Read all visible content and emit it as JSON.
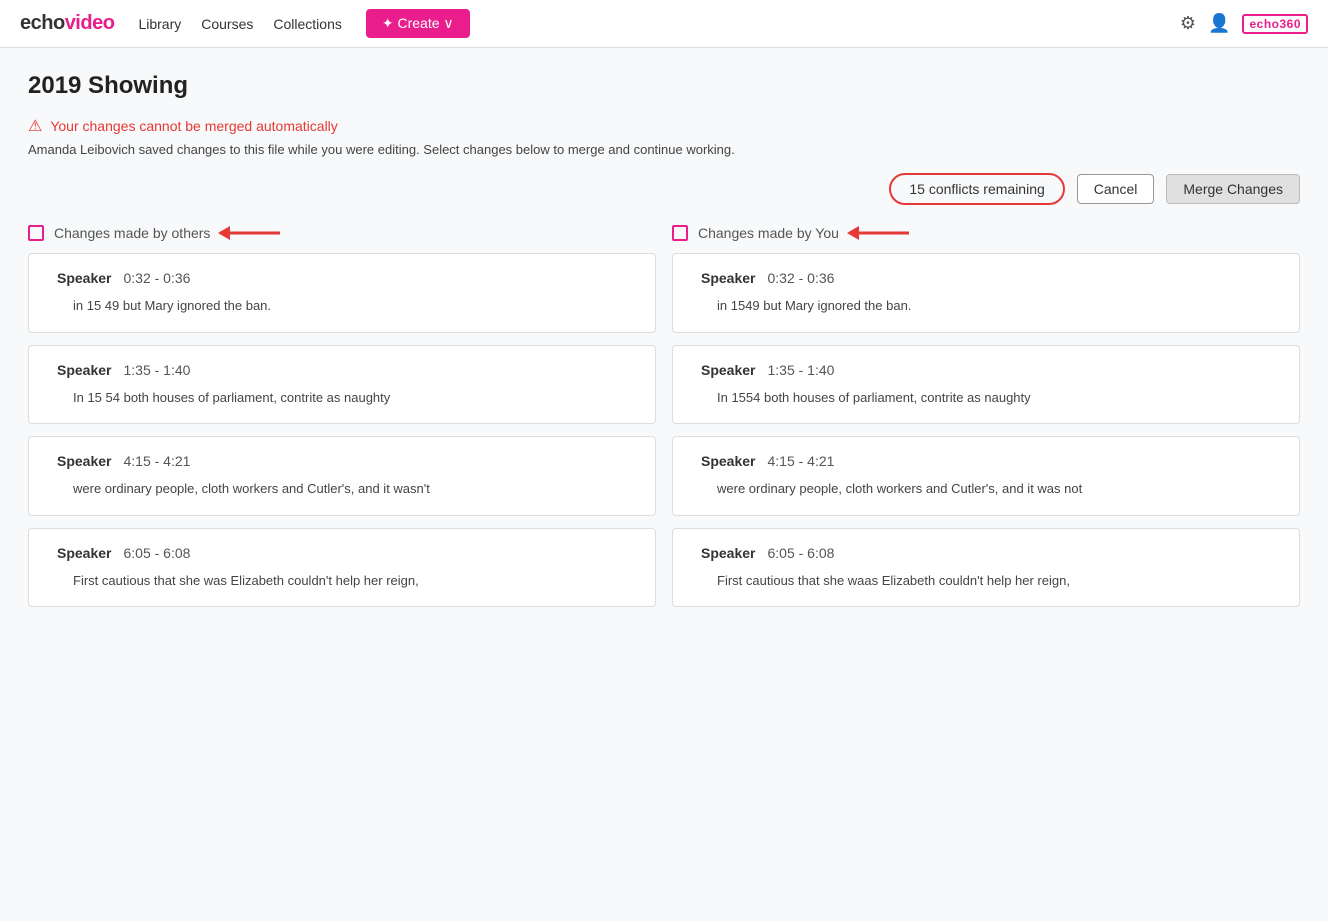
{
  "logo": {
    "echo": "echo",
    "video": "video"
  },
  "nav": {
    "links": [
      "Library",
      "Courses",
      "Collections"
    ],
    "create_label": "✦ Create ∨",
    "echo360_label": "echo360"
  },
  "page": {
    "title": "2019 Showing"
  },
  "alert": {
    "warning_text": "Your changes cannot be merged automatically",
    "description": "Amanda Leibovich saved changes to this file while you were editing. Select changes below to merge and continue working."
  },
  "action_bar": {
    "conflicts_label": "15 conflicts remaining",
    "cancel_label": "Cancel",
    "merge_label": "Merge Changes"
  },
  "columns": {
    "left": {
      "header": "Changes made by others",
      "cards": [
        {
          "speaker": "Speaker",
          "time": "0:32 - 0:36",
          "text": "in 15 49 but Mary ignored the ban."
        },
        {
          "speaker": "Speaker",
          "time": "1:35 - 1:40",
          "text": "In 15 54 both houses of parliament, contrite as naughty"
        },
        {
          "speaker": "Speaker",
          "time": "4:15 - 4:21",
          "text": "were ordinary people, cloth workers and Cutler's, and it wasn't"
        },
        {
          "speaker": "Speaker",
          "time": "6:05 - 6:08",
          "text": "First cautious that she was Elizabeth couldn't help her reign,"
        }
      ]
    },
    "right": {
      "header": "Changes made by You",
      "cards": [
        {
          "speaker": "Speaker",
          "time": "0:32 - 0:36",
          "text": "in 1549 but Mary ignored the ban."
        },
        {
          "speaker": "Speaker",
          "time": "1:35 - 1:40",
          "text": "In 1554 both houses of parliament, contrite as naughty"
        },
        {
          "speaker": "Speaker",
          "time": "4:15 - 4:21",
          "text": "were ordinary people, cloth workers and Cutler's, and it was not"
        },
        {
          "speaker": "Speaker",
          "time": "6:05 - 6:08",
          "text": "First cautious that she waas Elizabeth couldn't help her reign,"
        }
      ]
    }
  }
}
